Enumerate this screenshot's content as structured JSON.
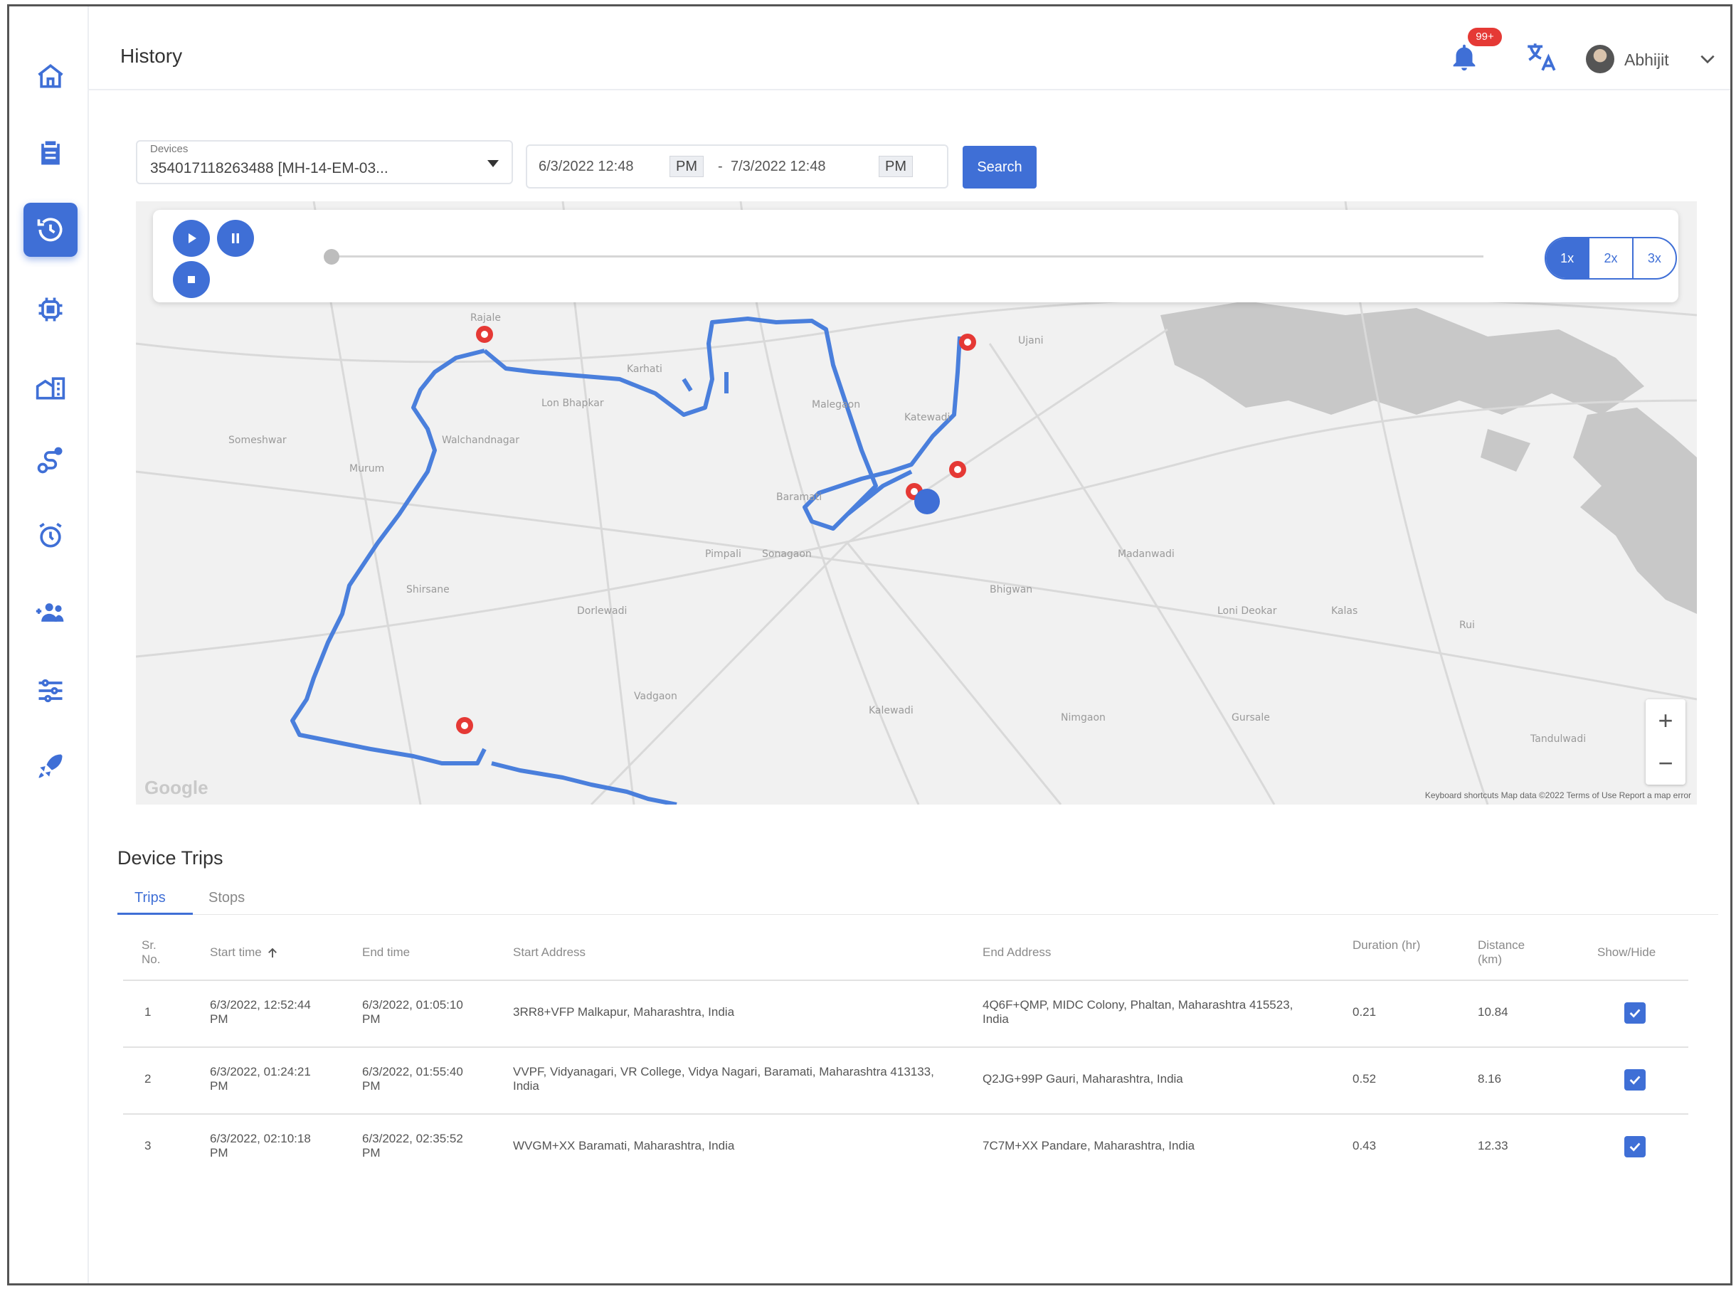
{
  "header": {
    "title": "History",
    "notification_count": "99+",
    "user_name": "Abhijit"
  },
  "sidebar": {
    "items": [
      {
        "name": "home",
        "icon": "home-icon"
      },
      {
        "name": "reports",
        "icon": "clipboard-icon"
      },
      {
        "name": "history",
        "icon": "history-icon",
        "active": true
      },
      {
        "name": "devices",
        "icon": "device-icon"
      },
      {
        "name": "geofence",
        "icon": "building-icon"
      },
      {
        "name": "routes",
        "icon": "route-icon"
      },
      {
        "name": "alarms",
        "icon": "alarm-icon"
      },
      {
        "name": "users",
        "icon": "add-users-icon"
      },
      {
        "name": "settings",
        "icon": "sliders-icon"
      },
      {
        "name": "tracking",
        "icon": "rocket-icon"
      }
    ]
  },
  "filters": {
    "device_label": "Devices",
    "device_value": "354017118263488 [MH-14-EM-03...",
    "date_from": "6/3/2022 12:48",
    "date_from_ampm": "PM",
    "date_to": "7/3/2022 12:48",
    "date_to_ampm": "PM",
    "search_label": "Search"
  },
  "playback": {
    "speeds": [
      "1x",
      "2x",
      "3x"
    ],
    "active_speed": "1x",
    "progress": 0
  },
  "map": {
    "zoom_in": "+",
    "zoom_out": "−",
    "google": "Google",
    "footer": "Keyboard shortcuts   Map data ©2022   Terms of Use   Report a map error"
  },
  "trips": {
    "title": "Device Trips",
    "tabs": [
      "Trips",
      "Stops"
    ],
    "active_tab": "Trips",
    "columns": [
      "Sr. No.",
      "Start time",
      "End time",
      "Start Address",
      "End Address",
      "Duration (hr)",
      "Distance (km)",
      "Show/Hide"
    ],
    "rows": [
      {
        "sr": "1",
        "start_time": "6/3/2022, 12:52:44 PM",
        "end_time": "6/3/2022, 01:05:10 PM",
        "start_address": "3RR8+VFP Malkapur, Maharashtra, India",
        "end_address": "4Q6F+QMP, MIDC Colony, Phaltan, Maharashtra 415523, India",
        "duration": "0.21",
        "distance": "10.84",
        "shown": true
      },
      {
        "sr": "2",
        "start_time": "6/3/2022, 01:24:21 PM",
        "end_time": "6/3/2022, 01:55:40 PM",
        "start_address": "VVPF, Vidyanagari, VR College, Vidya Nagari, Baramati, Maharashtra 413133, India",
        "end_address": "Q2JG+99P Gauri, Maharashtra, India",
        "duration": "0.52",
        "distance": "8.16",
        "shown": true
      },
      {
        "sr": "3",
        "start_time": "6/3/2022, 02:10:18 PM",
        "end_time": "6/3/2022, 02:35:52 PM",
        "start_address": "WVGM+XX Baramati, Maharashtra, India",
        "end_address": "7C7M+XX Pandare, Maharashtra, India",
        "duration": "0.43",
        "distance": "12.33",
        "shown": true
      }
    ]
  },
  "colors": {
    "accent": "#3f6fd6",
    "badge": "#e53935",
    "route": "#4a7fdc",
    "marker": "#e53935"
  }
}
